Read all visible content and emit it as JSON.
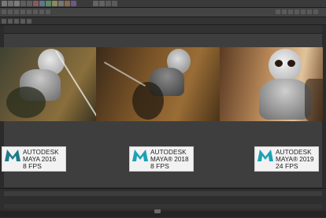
{
  "window": {
    "app_name": "Maya"
  },
  "comparison": [
    {
      "brand": "AUTODESK",
      "product": "MAYA 2016",
      "fps": "8 FPS",
      "logo_color": "#1f7a8c"
    },
    {
      "brand": "AUTODESK",
      "product": "MAYA® 2018",
      "fps": "8 FPS",
      "logo_color": "#1aa2b4"
    },
    {
      "brand": "AUTODESK",
      "product": "MAYA® 2019",
      "fps": "24 FPS",
      "logo_color": "#1aa2b4"
    }
  ],
  "colors": {
    "ui_dark": "#2b2b2b",
    "ui_mid": "#3b3b3b",
    "card_bg": "#f2f2f2",
    "text_dark": "#222222"
  }
}
